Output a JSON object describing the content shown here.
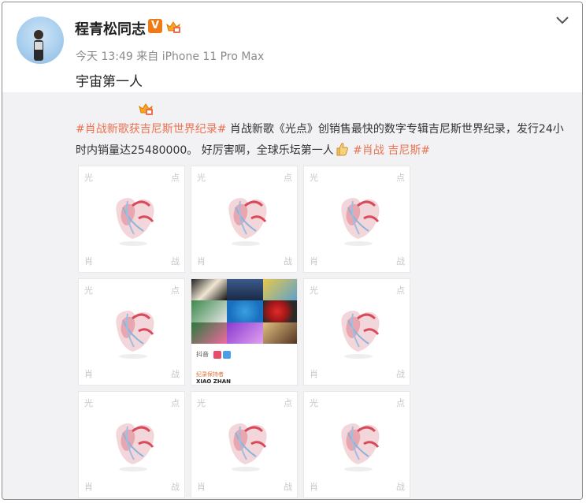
{
  "user": {
    "name": "程青松同志",
    "verified_badge": "V",
    "meta_time": "今天 13:49",
    "meta_source": "来自 iPhone 11 Pro Max",
    "post_text": "宇宙第一人"
  },
  "repost": {
    "tag1": "#肖战新歌获吉尼斯世界纪录#",
    "text1": " 肖战新歌《光点》创销售最快的数字专辑吉尼斯世界纪录，发行24小时内销量达25480000。    好厉害啊，全球乐坛第一人",
    "tag2": "#肖战 吉尼斯#"
  },
  "tile_corners": {
    "tl": "光",
    "tr": "点",
    "bl": "肖",
    "br": "战"
  },
  "collage": {
    "caption_orange": "纪录保持者",
    "caption_name": "XIAO ZHAN",
    "logo_text": "抖音"
  },
  "colors": {
    "tag": "#eb7350",
    "badge": "#f07b16",
    "meta": "#8a8a8a"
  },
  "icons": [
    "crown-icon",
    "chevron-down-icon",
    "thumbs-up-icon"
  ]
}
